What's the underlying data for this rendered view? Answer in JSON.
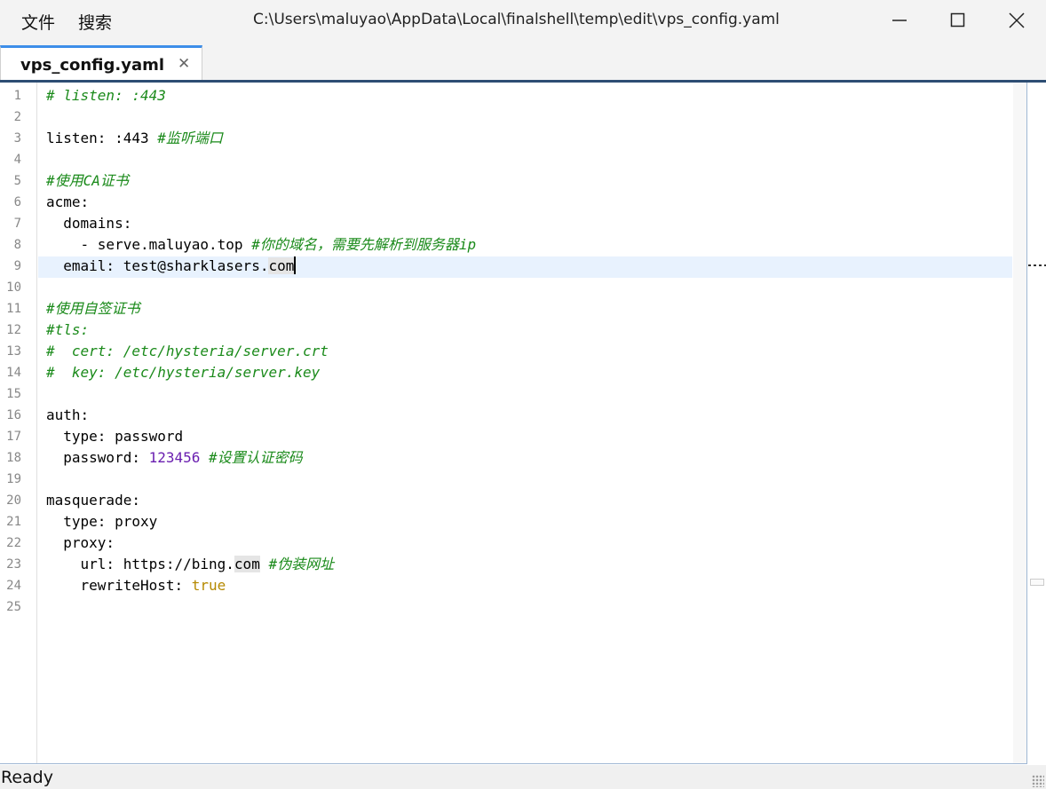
{
  "menu": {
    "file": "文件",
    "search": "搜索"
  },
  "window": {
    "title": "C:\\Users\\maluyao\\AppData\\Local\\finalshell\\temp\\edit\\vps_config.yaml"
  },
  "icons": {
    "minimize": "minimize-icon",
    "maximize": "maximize-icon",
    "close": "close-icon",
    "tab_close": "close-tab-icon"
  },
  "tab": {
    "label": "vps_config.yaml",
    "close": "✕"
  },
  "colors": {
    "comment": "#1a8a1a",
    "number": "#6a1fb0",
    "boolean": "#b58900",
    "tab_accent": "#3d8ee8",
    "current_line": "#e8f2fe"
  },
  "editor": {
    "current_line": 9,
    "lines": [
      {
        "n": "1",
        "t": [
          {
            "s": "# listen: :443",
            "k": "c"
          }
        ]
      },
      {
        "n": "2",
        "t": []
      },
      {
        "n": "3",
        "t": [
          {
            "s": "listen: :443 ",
            "k": ""
          },
          {
            "s": "#监听端口",
            "k": "c"
          }
        ]
      },
      {
        "n": "4",
        "t": []
      },
      {
        "n": "5",
        "t": [
          {
            "s": "#使用CA证书",
            "k": "c"
          }
        ]
      },
      {
        "n": "6",
        "t": [
          {
            "s": "acme:",
            "k": ""
          }
        ]
      },
      {
        "n": "7",
        "t": [
          {
            "s": "  domains:",
            "k": ""
          }
        ]
      },
      {
        "n": "8",
        "t": [
          {
            "s": "    - serve.maluyao.top ",
            "k": ""
          },
          {
            "s": "#你的域名，需要先解析到服务器ip",
            "k": "c"
          }
        ]
      },
      {
        "n": "9",
        "t": [
          {
            "s": "  email: test@sharklasers.",
            "k": ""
          },
          {
            "s": "com",
            "k": "hl"
          },
          {
            "s": "",
            "k": "caret"
          }
        ]
      },
      {
        "n": "10",
        "t": []
      },
      {
        "n": "11",
        "t": [
          {
            "s": "#使用自签证书",
            "k": "c"
          }
        ]
      },
      {
        "n": "12",
        "t": [
          {
            "s": "#tls:",
            "k": "c"
          }
        ]
      },
      {
        "n": "13",
        "t": [
          {
            "s": "#  cert: /etc/hysteria/server.crt",
            "k": "c"
          }
        ]
      },
      {
        "n": "14",
        "t": [
          {
            "s": "#  key: /etc/hysteria/server.key",
            "k": "c"
          }
        ]
      },
      {
        "n": "15",
        "t": []
      },
      {
        "n": "16",
        "t": [
          {
            "s": "auth:",
            "k": ""
          }
        ]
      },
      {
        "n": "17",
        "t": [
          {
            "s": "  type: password",
            "k": ""
          }
        ]
      },
      {
        "n": "18",
        "t": [
          {
            "s": "  password: ",
            "k": ""
          },
          {
            "s": "123456",
            "k": "n"
          },
          {
            "s": " ",
            "k": ""
          },
          {
            "s": "#设置认证密码",
            "k": "c"
          }
        ]
      },
      {
        "n": "19",
        "t": []
      },
      {
        "n": "20",
        "t": [
          {
            "s": "masquerade:",
            "k": ""
          }
        ]
      },
      {
        "n": "21",
        "t": [
          {
            "s": "  type: proxy",
            "k": ""
          }
        ]
      },
      {
        "n": "22",
        "t": [
          {
            "s": "  proxy:",
            "k": ""
          }
        ]
      },
      {
        "n": "23",
        "t": [
          {
            "s": "    url: https://bing.",
            "k": ""
          },
          {
            "s": "com",
            "k": "hl"
          },
          {
            "s": " ",
            "k": ""
          },
          {
            "s": "#伪装网址",
            "k": "c"
          }
        ]
      },
      {
        "n": "24",
        "t": [
          {
            "s": "    rewriteHost: ",
            "k": ""
          },
          {
            "s": "true",
            "k": "b"
          }
        ]
      },
      {
        "n": "25",
        "t": []
      }
    ]
  },
  "status": {
    "text": "Ready"
  }
}
